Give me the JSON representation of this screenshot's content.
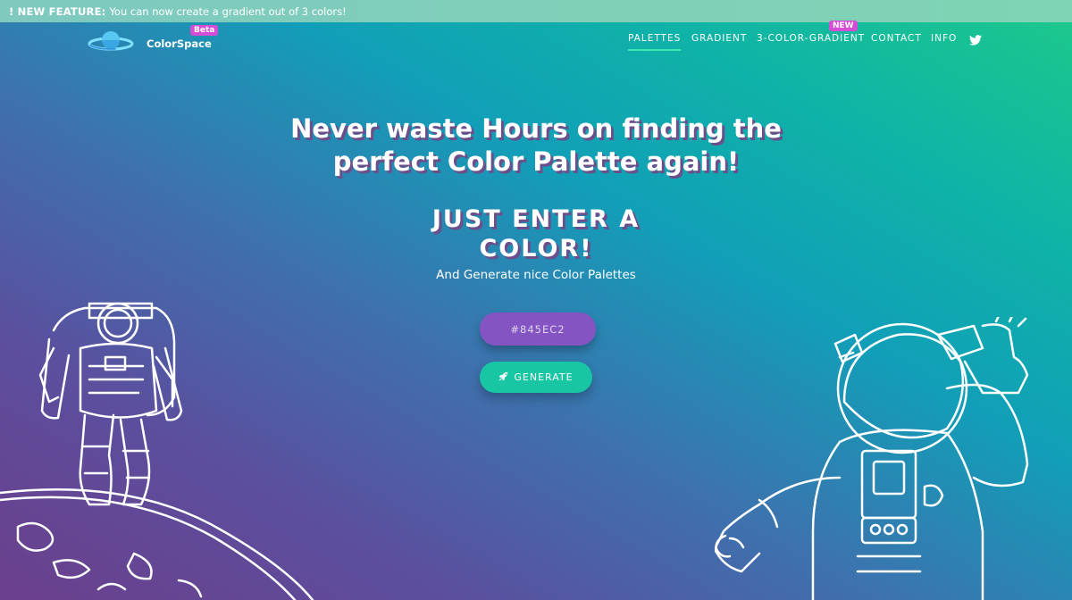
{
  "announcement": {
    "tag": "! NEW FEATURE:",
    "message": "You can now create a gradient out of 3 colors!"
  },
  "brand": {
    "name": "ColorSpace",
    "badge": "Beta",
    "logo_icon": "planet-ufo-icon"
  },
  "nav": {
    "items": [
      {
        "label": "PALETTES",
        "active": true
      },
      {
        "label": "GRADIENT",
        "active": false
      },
      {
        "label": "3-COLOR-GRADIENT",
        "active": false
      },
      {
        "label": "CONTACT",
        "active": false
      },
      {
        "label": "INFO",
        "active": false
      }
    ],
    "new_badge": "NEW",
    "social_icon": "twitter-icon"
  },
  "hero": {
    "title_line1": "Never waste Hours on finding the",
    "title_line2": "perfect Color Palette again!",
    "subtitle_line1": "JUST ENTER A",
    "subtitle_line2": "COLOR!",
    "tagline": "And Generate nice Color Palettes"
  },
  "form": {
    "color_value": "#845EC2",
    "generate_label": "GENERATE",
    "generate_icon": "rocket-icon"
  },
  "colors": {
    "input_bg": "#845EC2",
    "button_bg": "#19C6A4",
    "badge_bg": "#D54CD6"
  }
}
